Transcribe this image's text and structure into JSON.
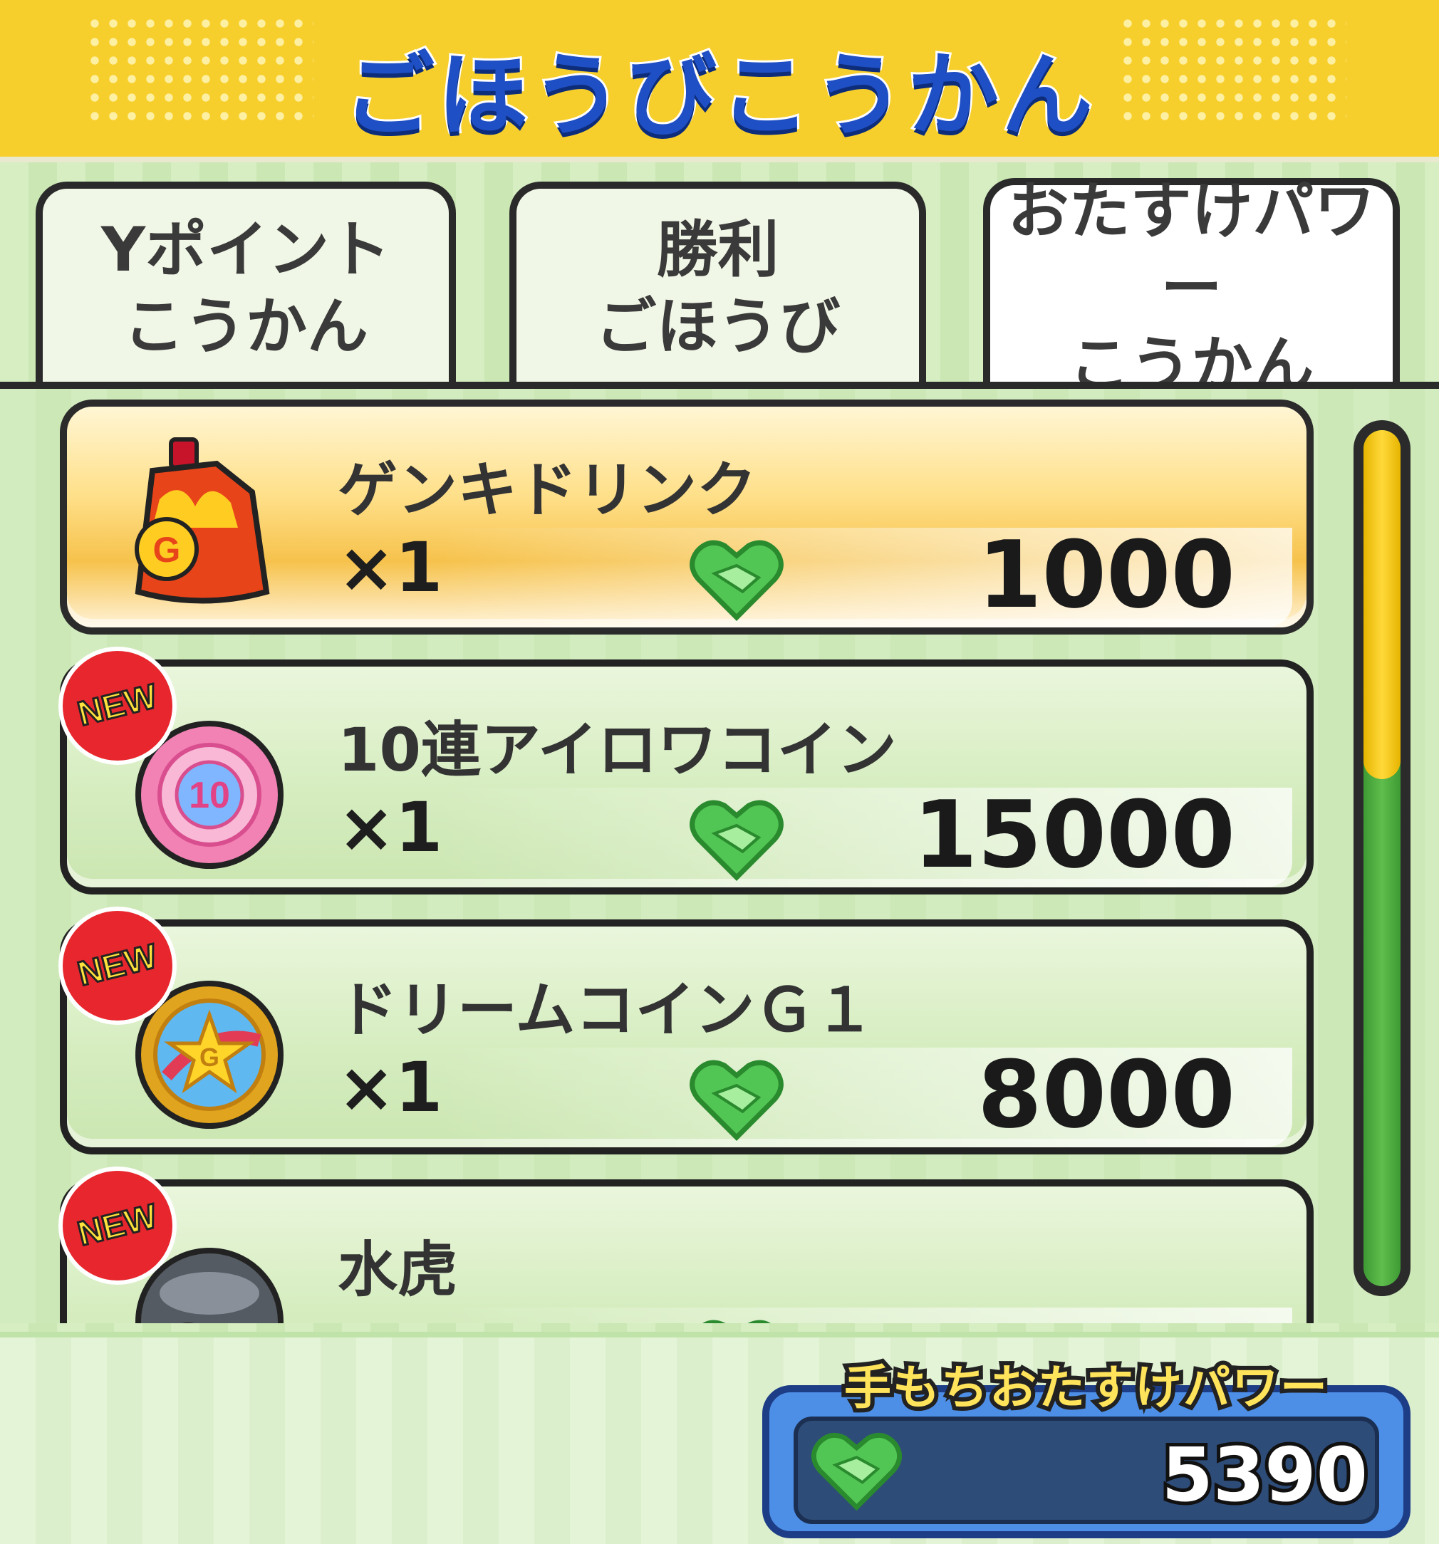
{
  "header": {
    "title": "ごほうびこうかん"
  },
  "tabs": [
    {
      "line1": "Yポイント",
      "line2": "こうかん",
      "active": false
    },
    {
      "line1": "勝利",
      "line2": "ごほうび",
      "active": false
    },
    {
      "line1": "おたすけパワー",
      "line2": "こうかん",
      "active": true
    }
  ],
  "items": [
    {
      "name": "ゲンキドリンク",
      "qty": "×1",
      "price": "1000",
      "new": false,
      "icon": "genki-drink-icon"
    },
    {
      "name": "10連アイロワコイン",
      "qty": "×1",
      "price": "15000",
      "new": true,
      "badge": "NEW",
      "icon_text": "10",
      "icon": "iroiwa-coin-icon"
    },
    {
      "name": "ドリームコインＧ１",
      "qty": "×1",
      "price": "8000",
      "new": true,
      "badge": "NEW",
      "icon_text": "G",
      "icon": "dream-coin-icon"
    },
    {
      "name": "水虎",
      "new": true,
      "badge": "NEW",
      "icon": "suiko-icon"
    }
  ],
  "footer": {
    "label": "手もちおたすけパワー",
    "value": "5390"
  },
  "colors": {
    "header": "#f7cf2d",
    "title": "#1f4fc4",
    "panel": "#d3ecbf",
    "selected_card": "#ffe08a",
    "heart": "#52c654",
    "scroll_thumb": "#ffd93a",
    "power_box": "#4d8fe6"
  }
}
